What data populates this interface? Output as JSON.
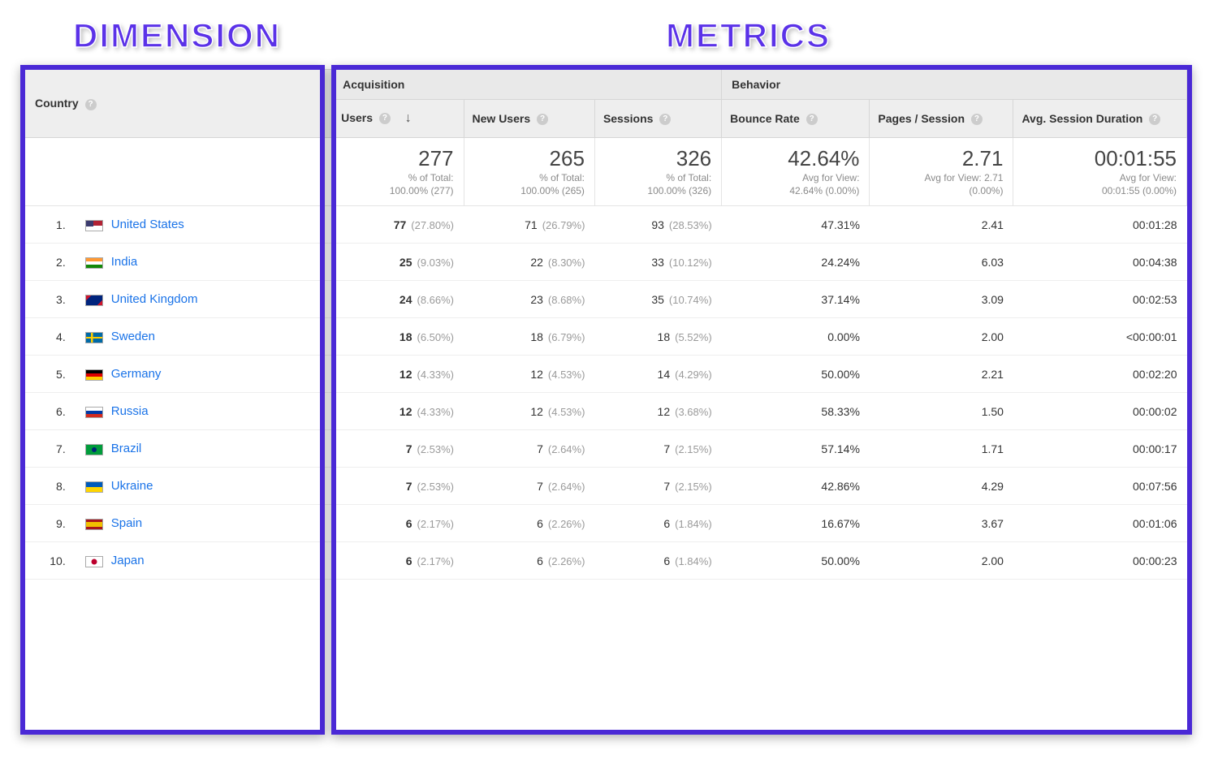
{
  "annotations": {
    "dimension_label": "DIMENSION",
    "metrics_label": "METRICS"
  },
  "table": {
    "dimension_header": "Country",
    "group_headers": {
      "acquisition": "Acquisition",
      "behavior": "Behavior"
    },
    "metric_headers": {
      "users": "Users",
      "new_users": "New Users",
      "sessions": "Sessions",
      "bounce_rate": "Bounce Rate",
      "pages_session": "Pages / Session",
      "avg_session_duration": "Avg. Session Duration"
    },
    "summary": {
      "users": {
        "big": "277",
        "sub1": "% of Total:",
        "sub2": "100.00% (277)"
      },
      "new_users": {
        "big": "265",
        "sub1": "% of Total:",
        "sub2": "100.00% (265)"
      },
      "sessions": {
        "big": "326",
        "sub1": "% of Total:",
        "sub2": "100.00% (326)"
      },
      "bounce_rate": {
        "big": "42.64%",
        "sub1": "Avg for View:",
        "sub2": "42.64% (0.00%)"
      },
      "pages_session": {
        "big": "2.71",
        "sub1": "Avg for View: 2.71",
        "sub2": "(0.00%)"
      },
      "avg_duration": {
        "big": "00:01:55",
        "sub1": "Avg for View:",
        "sub2": "00:01:55 (0.00%)"
      }
    },
    "rows": [
      {
        "rank": "1.",
        "flag": "us",
        "country": "United States",
        "users": "77",
        "users_pct": "(27.80%)",
        "new_users": "71",
        "new_users_pct": "(26.79%)",
        "sessions": "93",
        "sessions_pct": "(28.53%)",
        "bounce": "47.31%",
        "ps": "2.41",
        "asd": "00:01:28"
      },
      {
        "rank": "2.",
        "flag": "in",
        "country": "India",
        "users": "25",
        "users_pct": "(9.03%)",
        "new_users": "22",
        "new_users_pct": "(8.30%)",
        "sessions": "33",
        "sessions_pct": "(10.12%)",
        "bounce": "24.24%",
        "ps": "6.03",
        "asd": "00:04:38"
      },
      {
        "rank": "3.",
        "flag": "gb",
        "country": "United Kingdom",
        "users": "24",
        "users_pct": "(8.66%)",
        "new_users": "23",
        "new_users_pct": "(8.68%)",
        "sessions": "35",
        "sessions_pct": "(10.74%)",
        "bounce": "37.14%",
        "ps": "3.09",
        "asd": "00:02:53"
      },
      {
        "rank": "4.",
        "flag": "se",
        "country": "Sweden",
        "users": "18",
        "users_pct": "(6.50%)",
        "new_users": "18",
        "new_users_pct": "(6.79%)",
        "sessions": "18",
        "sessions_pct": "(5.52%)",
        "bounce": "0.00%",
        "ps": "2.00",
        "asd": "<00:00:01"
      },
      {
        "rank": "5.",
        "flag": "de",
        "country": "Germany",
        "users": "12",
        "users_pct": "(4.33%)",
        "new_users": "12",
        "new_users_pct": "(4.53%)",
        "sessions": "14",
        "sessions_pct": "(4.29%)",
        "bounce": "50.00%",
        "ps": "2.21",
        "asd": "00:02:20"
      },
      {
        "rank": "6.",
        "flag": "ru",
        "country": "Russia",
        "users": "12",
        "users_pct": "(4.33%)",
        "new_users": "12",
        "new_users_pct": "(4.53%)",
        "sessions": "12",
        "sessions_pct": "(3.68%)",
        "bounce": "58.33%",
        "ps": "1.50",
        "asd": "00:00:02"
      },
      {
        "rank": "7.",
        "flag": "br",
        "country": "Brazil",
        "users": "7",
        "users_pct": "(2.53%)",
        "new_users": "7",
        "new_users_pct": "(2.64%)",
        "sessions": "7",
        "sessions_pct": "(2.15%)",
        "bounce": "57.14%",
        "ps": "1.71",
        "asd": "00:00:17"
      },
      {
        "rank": "8.",
        "flag": "ua",
        "country": "Ukraine",
        "users": "7",
        "users_pct": "(2.53%)",
        "new_users": "7",
        "new_users_pct": "(2.64%)",
        "sessions": "7",
        "sessions_pct": "(2.15%)",
        "bounce": "42.86%",
        "ps": "4.29",
        "asd": "00:07:56"
      },
      {
        "rank": "9.",
        "flag": "es",
        "country": "Spain",
        "users": "6",
        "users_pct": "(2.17%)",
        "new_users": "6",
        "new_users_pct": "(2.26%)",
        "sessions": "6",
        "sessions_pct": "(1.84%)",
        "bounce": "16.67%",
        "ps": "3.67",
        "asd": "00:01:06"
      },
      {
        "rank": "10.",
        "flag": "jp",
        "country": "Japan",
        "users": "6",
        "users_pct": "(2.17%)",
        "new_users": "6",
        "new_users_pct": "(2.26%)",
        "sessions": "6",
        "sessions_pct": "(1.84%)",
        "bounce": "50.00%",
        "ps": "2.00",
        "asd": "00:00:23"
      }
    ]
  }
}
